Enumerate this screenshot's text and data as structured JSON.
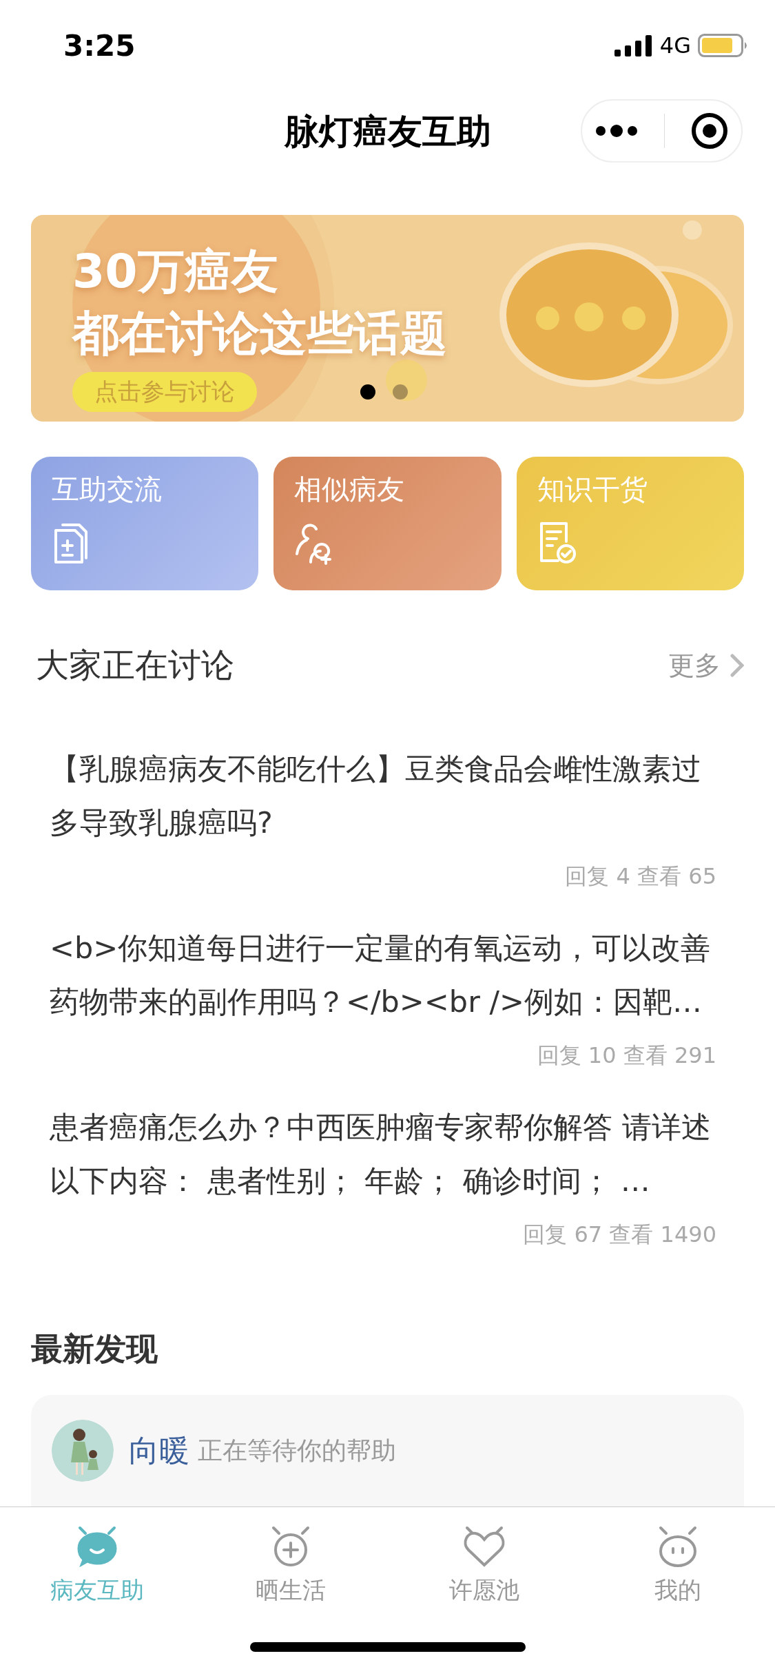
{
  "status_bar": {
    "time": "3:25",
    "network": "4G"
  },
  "nav": {
    "title": "脉灯癌友互助"
  },
  "banner": {
    "headline": "30万癌友",
    "subline": "都在讨论这些话题",
    "button": "点击参与讨论",
    "dots": [
      {
        "selected": true
      },
      {
        "selected": false
      }
    ]
  },
  "shortcuts": [
    {
      "label": "互助交流",
      "kind": "document"
    },
    {
      "label": "相似病友",
      "kind": "people"
    },
    {
      "label": "知识干货",
      "kind": "checklist"
    }
  ],
  "discussion": {
    "title": "大家正在讨论",
    "more": "更多",
    "topics": [
      {
        "text": "【乳腺癌病友不能吃什么】豆类食品会雌性激素过多导致乳腺癌吗?",
        "meta": "回复 4 查看 65"
      },
      {
        "text": "<b>你知道每日进行一定量的有氧运动，可以改善药物带来的副作用吗？</b><br />例如：因靶…",
        "meta": "回复 10 查看 291"
      },
      {
        "text": "患者癌痛怎么办？中西医肿瘤专家帮你解答 请详述以下内容：  患者性别；  年龄；  确诊时间；  …",
        "meta": "回复 67 查看 1490"
      }
    ]
  },
  "latest": {
    "title": "最新发现",
    "post": {
      "user": "向暖",
      "status": "正在等待你的帮助"
    }
  },
  "tab_bar": [
    {
      "label": "病友互助",
      "kind": "chat",
      "selected": true
    },
    {
      "label": "晒生活",
      "kind": "plus",
      "selected": false
    },
    {
      "label": "许愿池",
      "kind": "heart",
      "selected": false
    },
    {
      "label": "我的",
      "kind": "face",
      "selected": false
    }
  ]
}
